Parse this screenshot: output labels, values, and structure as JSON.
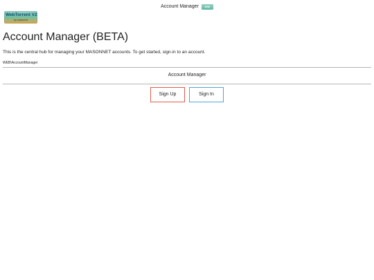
{
  "header": {
    "title": "Account Manager",
    "badge_text": "beta"
  },
  "logo": {
    "title": "WebTorrent V2",
    "subtitle": "by masonnet"
  },
  "main": {
    "title": "Account Manager (BETA)",
    "description": "This is the central hub for managing your MASONNET accounts. To get started, sign-in to an account.",
    "path": "WEB\\AccountManager",
    "section_title": "Account Manager"
  },
  "actions": {
    "sign_up_label": "Sign Up",
    "sign_in_label": "Sign In"
  },
  "colors": {
    "sign_up_border": "#e25a4b",
    "sign_in_border": "#4fa3d9",
    "divider": "#b5b5b5"
  }
}
